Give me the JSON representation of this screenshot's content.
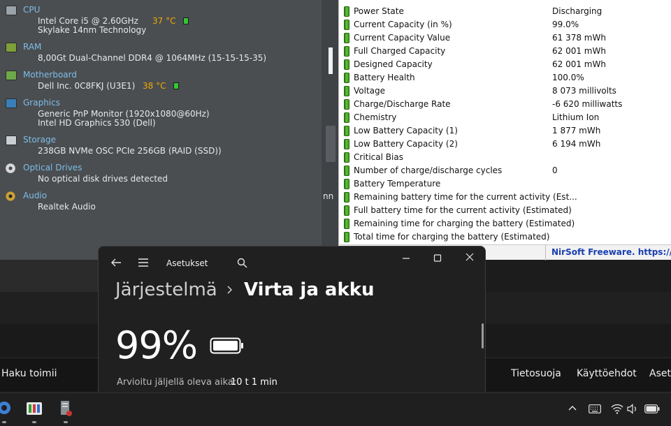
{
  "speccy": {
    "sections": [
      {
        "title": "CPU",
        "lines": [
          "Intel Core i5 @ 2.60GHz",
          "Skylake 14nm Technology"
        ],
        "temp": "37 °C"
      },
      {
        "title": "RAM",
        "lines": [
          "8,00Gt Dual-Channel DDR4 @ 1064MHz (15-15-15-35)"
        ]
      },
      {
        "title": "Motherboard",
        "lines": [
          "Dell Inc. 0C8FKJ (U3E1)"
        ],
        "temp": "38 °C"
      },
      {
        "title": "Graphics",
        "lines": [
          "Generic PnP Monitor (1920x1080@60Hz)",
          "Intel HD Graphics 530 (Dell)"
        ]
      },
      {
        "title": "Storage",
        "lines": [
          "238GB NVMe OSC PCIe 256GB (RAID (SSD))"
        ]
      },
      {
        "title": "Optical Drives",
        "lines": [
          "No optical disk drives detected"
        ]
      },
      {
        "title": "Audio",
        "lines": [
          "Realtek Audio"
        ]
      }
    ],
    "truncated_text": "nn"
  },
  "battery_info": {
    "rows": [
      {
        "name": "Power State",
        "value": "Discharging"
      },
      {
        "name": "Current Capacity (in %)",
        "value": "99.0%"
      },
      {
        "name": "Current Capacity Value",
        "value": "61 378 mWh"
      },
      {
        "name": "Full Charged Capacity",
        "value": "62 001 mWh"
      },
      {
        "name": "Designed Capacity",
        "value": "62 001 mWh"
      },
      {
        "name": "Battery Health",
        "value": "100.0%"
      },
      {
        "name": "Voltage",
        "value": "8 073 millivolts"
      },
      {
        "name": "Charge/Discharge Rate",
        "value": "-6 620 milliwatts"
      },
      {
        "name": "Chemistry",
        "value": "Lithium Ion"
      },
      {
        "name": "Low Battery Capacity (1)",
        "value": "1 877 mWh"
      },
      {
        "name": "Low Battery Capacity (2)",
        "value": "6 194 mWh"
      },
      {
        "name": "Critical Bias",
        "value": ""
      },
      {
        "name": "Number of charge/discharge cycles",
        "value": "0"
      },
      {
        "name": "Battery Temperature",
        "value": ""
      },
      {
        "name": "Remaining battery time for the current activity (Est...",
        "value": ""
      },
      {
        "name": "Full battery time for the current activity (Estimated)",
        "value": ""
      },
      {
        "name": "Remaining time for charging the battery (Estimated)",
        "value": ""
      },
      {
        "name": "Total  time for charging the battery (Estimated)",
        "value": ""
      }
    ],
    "status_link": "NirSoft Freeware. https://www."
  },
  "settings": {
    "app_title": "Asetukset",
    "breadcrumb_parent": "Järjestelmä",
    "breadcrumb_current": "Virta ja akku",
    "battery_percent": "99%",
    "estimate_label": "Arvioitu jäljellä oleva aika:",
    "estimate_value": "10 t 1 min"
  },
  "web_nav": {
    "left_link": "Haku toimii",
    "right_links": [
      "Tietosuoja",
      "Käyttöehdot",
      "Asetu"
    ]
  },
  "colors": {
    "speccy_bg": "#4a4e51",
    "speccy_title": "#7fbde8",
    "temp": "#f2a800",
    "settings_bg": "#202020",
    "link_blue": "#1a3fb0"
  }
}
